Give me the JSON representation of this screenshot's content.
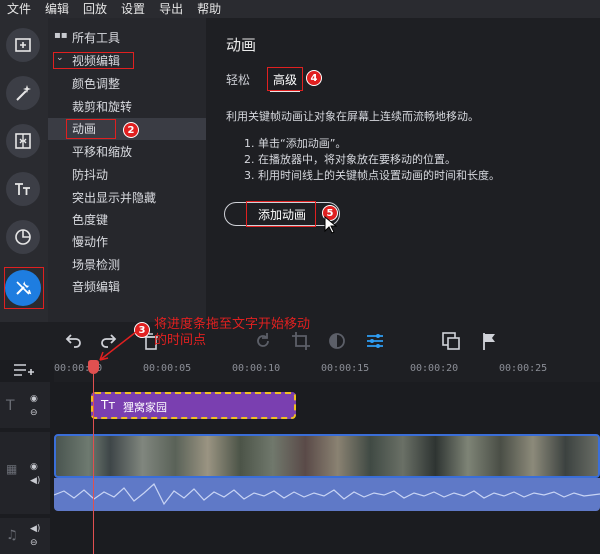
{
  "menubar": {
    "items": [
      "文件",
      "编辑",
      "回放",
      "设置",
      "导出",
      "帮助"
    ]
  },
  "rail": {
    "icons": [
      "import-icon",
      "magic-wand-icon",
      "transitions-icon",
      "titles-icon",
      "stickers-icon",
      "more-tools-icon"
    ]
  },
  "tools": {
    "all_tools": "所有工具",
    "video_editing": "视频编辑",
    "items": [
      "颜色调整",
      "裁剪和旋转",
      "动画",
      "平移和缩放",
      "防抖动",
      "突出显示并隐藏",
      "色度键",
      "慢动作",
      "场景检测",
      "音频编辑"
    ]
  },
  "settings": {
    "title": "动画",
    "tabs": [
      "轻松",
      "高级"
    ],
    "description": "利用关键帧动画让对象在屏幕上连续而流畅地移动。",
    "steps": [
      "1. 单击“添加动画”。",
      "2. 在播放器中，将对象放在要移动的位置。",
      "3. 利用时间线上的关键帧点设置动画的时间和长度。"
    ],
    "add_button": "添加动画"
  },
  "annotations": {
    "badges": [
      "1",
      "2",
      "3",
      "4",
      "5"
    ],
    "note": "将进度条拖至文字开始移动的时间点"
  },
  "timeline": {
    "ruler": [
      "00:00:00",
      "00:00:05",
      "00:00:10",
      "00:00:15",
      "00:00:20",
      "00:00:25"
    ],
    "title_clip": "狸窝家园",
    "playhead_time": "00:00:02"
  },
  "colors": {
    "accent": "#1e7de0",
    "clip_purple": "#7a3fb0",
    "clip_border": "#f0c020",
    "playhead": "#e05050",
    "annotation": "#e02020"
  }
}
